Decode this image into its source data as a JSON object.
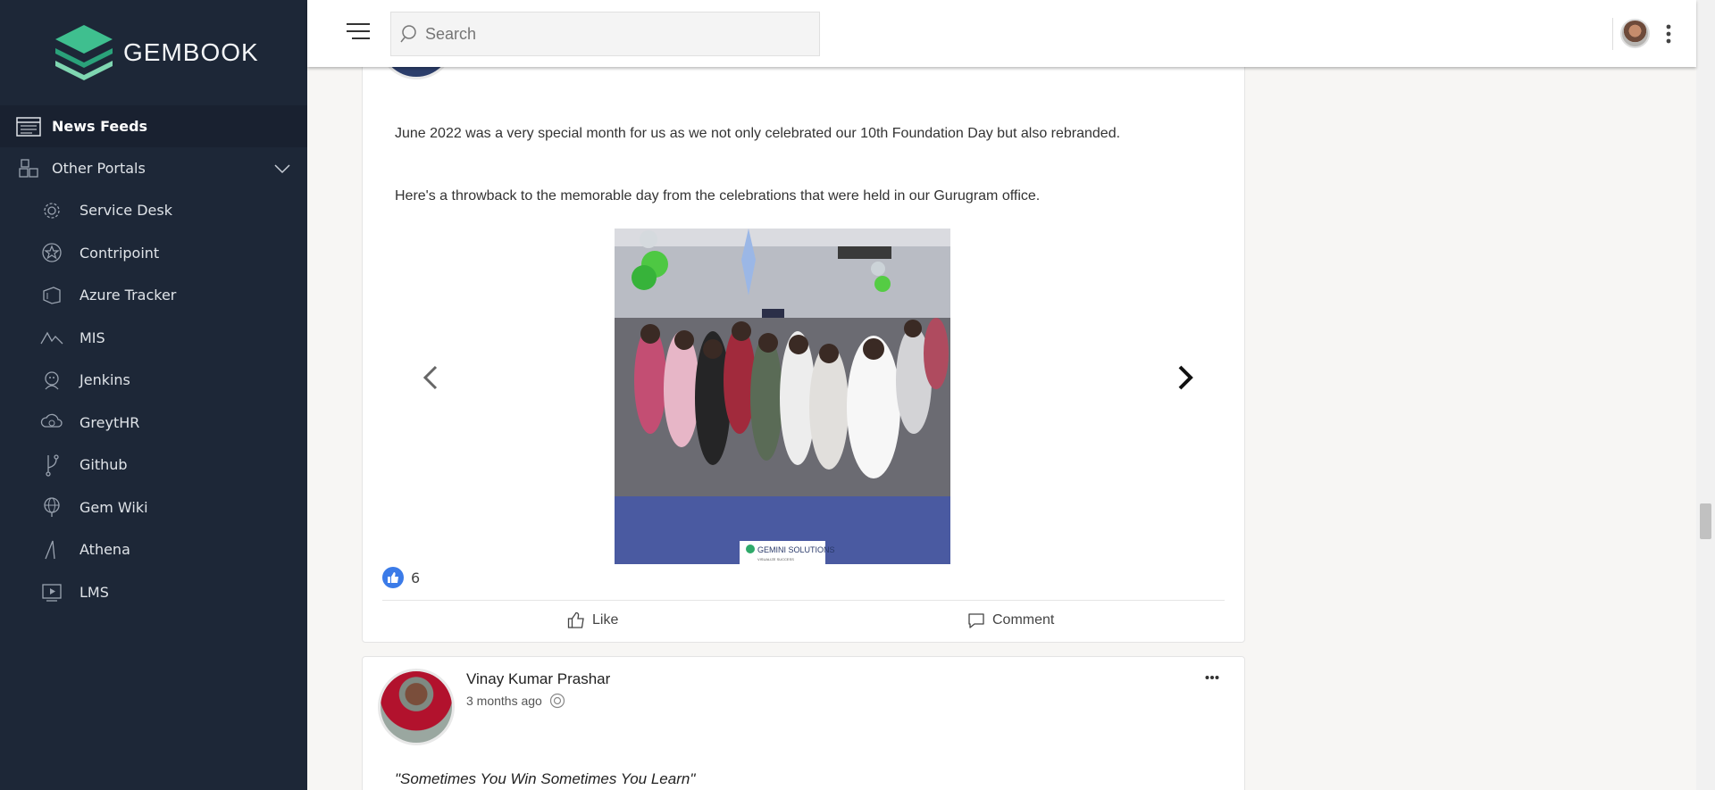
{
  "app": {
    "name": "GEMBOOK"
  },
  "header": {
    "search_placeholder": "Search"
  },
  "sidebar": {
    "top_items": [
      {
        "label": "News Feeds",
        "icon": "news-feed-icon"
      },
      {
        "label": "Other Portals",
        "icon": "portals-icon"
      }
    ],
    "portals": [
      {
        "label": "Service Desk",
        "icon": "gear-icon"
      },
      {
        "label": "Contripoint",
        "icon": "star-icon"
      },
      {
        "label": "Azure Tracker",
        "icon": "azure-icon"
      },
      {
        "label": "MIS",
        "icon": "chart-line-icon"
      },
      {
        "label": "Jenkins",
        "icon": "jenkins-icon"
      },
      {
        "label": "GreytHR",
        "icon": "cloud-icon"
      },
      {
        "label": "Github",
        "icon": "branch-icon"
      },
      {
        "label": "Gem Wiki",
        "icon": "globe-icon"
      },
      {
        "label": "Athena",
        "icon": "athena-icon"
      },
      {
        "label": "LMS",
        "icon": "video-icon"
      }
    ]
  },
  "post1": {
    "paragraph1": "June 2022 was a very special month for us as we not only celebrated our 10th Foundation Day but also rebranded.",
    "paragraph2": "Here's a throwback to the memorable day from the celebrations that were held in our Gurugram office.",
    "photo_caption": "GEMINI SOLUTIONS",
    "photo_tagline": "VISUALIZE SUCCESS",
    "like_count": "6",
    "like_label": "Like",
    "comment_label": "Comment"
  },
  "post2": {
    "author": "Vinay Kumar Prashar",
    "time": "3 months ago",
    "quote": "\"Sometimes You Win Sometimes You Learn\""
  },
  "colors": {
    "sidebar_bg": "#1d2737",
    "logo_green": "#3fbf8f",
    "like_blue": "#3b7be8"
  }
}
